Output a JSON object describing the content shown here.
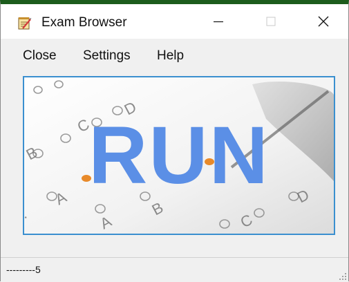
{
  "window": {
    "title": "Exam Browser",
    "icon": "notepad-icon",
    "controls": {
      "minimize_icon": "minimize-icon",
      "maximize_icon": "maximize-icon",
      "close_icon": "close-icon"
    }
  },
  "menu": {
    "items": [
      {
        "label": "Close"
      },
      {
        "label": "Settings"
      },
      {
        "label": "Help"
      }
    ]
  },
  "main": {
    "run_label": "RUN",
    "run_color": "#5b8fe6",
    "border_color": "#3a8fcf"
  },
  "status": {
    "text": "---------5"
  },
  "colors": {
    "titlebar_border": "#1c5c1c",
    "background": "#f0f0f0"
  }
}
